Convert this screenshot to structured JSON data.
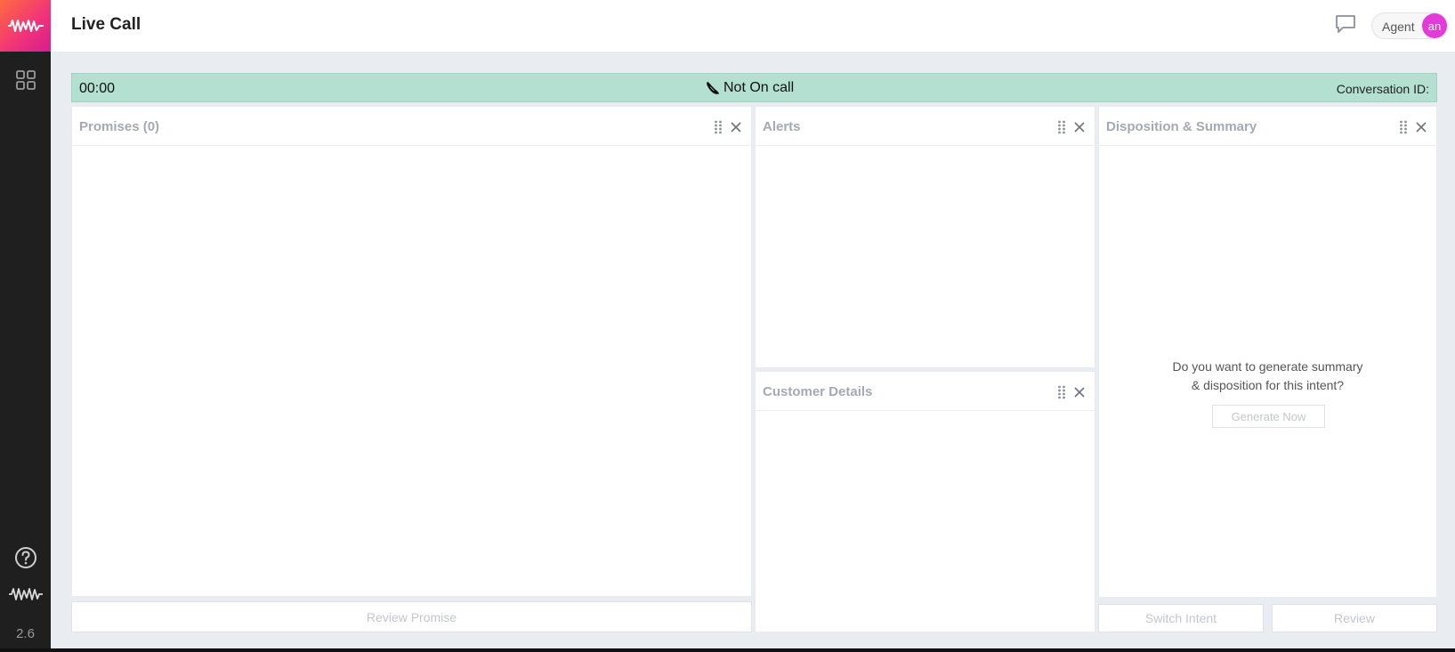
{
  "app": {
    "version": "2.6"
  },
  "header": {
    "title": "Live Call",
    "agent_label": "Agent",
    "avatar_initials": "an"
  },
  "status": {
    "timer": "00:00",
    "call_state": "Not On call",
    "conversation_label": "Conversation ID:"
  },
  "panels": {
    "promises": {
      "title": "Promises (0)",
      "action": "Review Promise"
    },
    "alerts": {
      "title": "Alerts"
    },
    "customer": {
      "title": "Customer Details"
    },
    "disposition": {
      "title": "Disposition & Summary",
      "prompt_line1": "Do you want to generate summary",
      "prompt_line2": "& disposition for this intent?",
      "generate_label": "Generate Now",
      "switch_label": "Switch Intent",
      "review_label": "Review"
    }
  },
  "colors": {
    "status_bar": "#b3e0d0",
    "avatar": "#e23bd8",
    "brand_gradient_start": "#ff6a3d",
    "brand_gradient_end": "#d41f8c"
  },
  "icons": [
    "logo-wave-icon",
    "grid-icon",
    "help-icon",
    "wave-icon",
    "chat-icon",
    "phone-off-icon",
    "drag-handle-icon",
    "close-icon"
  ]
}
